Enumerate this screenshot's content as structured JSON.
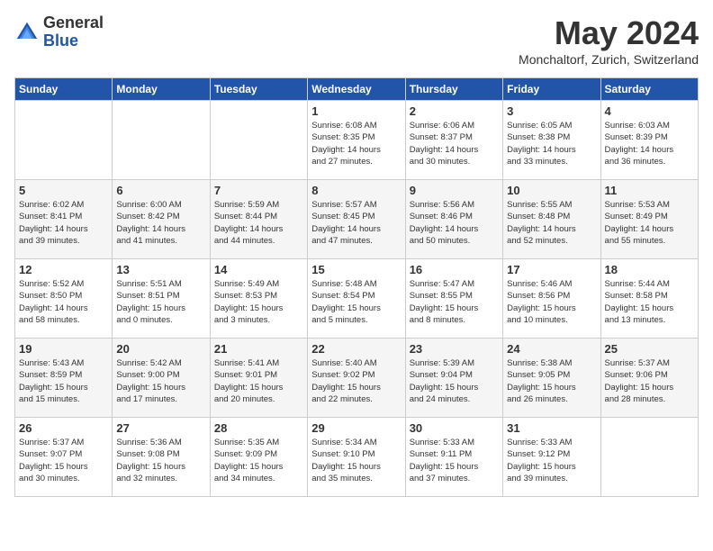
{
  "header": {
    "logo_general": "General",
    "logo_blue": "Blue",
    "title": "May 2024",
    "subtitle": "Monchaltorf, Zurich, Switzerland"
  },
  "weekdays": [
    "Sunday",
    "Monday",
    "Tuesday",
    "Wednesday",
    "Thursday",
    "Friday",
    "Saturday"
  ],
  "weeks": [
    [
      {
        "day": "",
        "info": ""
      },
      {
        "day": "",
        "info": ""
      },
      {
        "day": "",
        "info": ""
      },
      {
        "day": "1",
        "info": "Sunrise: 6:08 AM\nSunset: 8:35 PM\nDaylight: 14 hours\nand 27 minutes."
      },
      {
        "day": "2",
        "info": "Sunrise: 6:06 AM\nSunset: 8:37 PM\nDaylight: 14 hours\nand 30 minutes."
      },
      {
        "day": "3",
        "info": "Sunrise: 6:05 AM\nSunset: 8:38 PM\nDaylight: 14 hours\nand 33 minutes."
      },
      {
        "day": "4",
        "info": "Sunrise: 6:03 AM\nSunset: 8:39 PM\nDaylight: 14 hours\nand 36 minutes."
      }
    ],
    [
      {
        "day": "5",
        "info": "Sunrise: 6:02 AM\nSunset: 8:41 PM\nDaylight: 14 hours\nand 39 minutes."
      },
      {
        "day": "6",
        "info": "Sunrise: 6:00 AM\nSunset: 8:42 PM\nDaylight: 14 hours\nand 41 minutes."
      },
      {
        "day": "7",
        "info": "Sunrise: 5:59 AM\nSunset: 8:44 PM\nDaylight: 14 hours\nand 44 minutes."
      },
      {
        "day": "8",
        "info": "Sunrise: 5:57 AM\nSunset: 8:45 PM\nDaylight: 14 hours\nand 47 minutes."
      },
      {
        "day": "9",
        "info": "Sunrise: 5:56 AM\nSunset: 8:46 PM\nDaylight: 14 hours\nand 50 minutes."
      },
      {
        "day": "10",
        "info": "Sunrise: 5:55 AM\nSunset: 8:48 PM\nDaylight: 14 hours\nand 52 minutes."
      },
      {
        "day": "11",
        "info": "Sunrise: 5:53 AM\nSunset: 8:49 PM\nDaylight: 14 hours\nand 55 minutes."
      }
    ],
    [
      {
        "day": "12",
        "info": "Sunrise: 5:52 AM\nSunset: 8:50 PM\nDaylight: 14 hours\nand 58 minutes."
      },
      {
        "day": "13",
        "info": "Sunrise: 5:51 AM\nSunset: 8:51 PM\nDaylight: 15 hours\nand 0 minutes."
      },
      {
        "day": "14",
        "info": "Sunrise: 5:49 AM\nSunset: 8:53 PM\nDaylight: 15 hours\nand 3 minutes."
      },
      {
        "day": "15",
        "info": "Sunrise: 5:48 AM\nSunset: 8:54 PM\nDaylight: 15 hours\nand 5 minutes."
      },
      {
        "day": "16",
        "info": "Sunrise: 5:47 AM\nSunset: 8:55 PM\nDaylight: 15 hours\nand 8 minutes."
      },
      {
        "day": "17",
        "info": "Sunrise: 5:46 AM\nSunset: 8:56 PM\nDaylight: 15 hours\nand 10 minutes."
      },
      {
        "day": "18",
        "info": "Sunrise: 5:44 AM\nSunset: 8:58 PM\nDaylight: 15 hours\nand 13 minutes."
      }
    ],
    [
      {
        "day": "19",
        "info": "Sunrise: 5:43 AM\nSunset: 8:59 PM\nDaylight: 15 hours\nand 15 minutes."
      },
      {
        "day": "20",
        "info": "Sunrise: 5:42 AM\nSunset: 9:00 PM\nDaylight: 15 hours\nand 17 minutes."
      },
      {
        "day": "21",
        "info": "Sunrise: 5:41 AM\nSunset: 9:01 PM\nDaylight: 15 hours\nand 20 minutes."
      },
      {
        "day": "22",
        "info": "Sunrise: 5:40 AM\nSunset: 9:02 PM\nDaylight: 15 hours\nand 22 minutes."
      },
      {
        "day": "23",
        "info": "Sunrise: 5:39 AM\nSunset: 9:04 PM\nDaylight: 15 hours\nand 24 minutes."
      },
      {
        "day": "24",
        "info": "Sunrise: 5:38 AM\nSunset: 9:05 PM\nDaylight: 15 hours\nand 26 minutes."
      },
      {
        "day": "25",
        "info": "Sunrise: 5:37 AM\nSunset: 9:06 PM\nDaylight: 15 hours\nand 28 minutes."
      }
    ],
    [
      {
        "day": "26",
        "info": "Sunrise: 5:37 AM\nSunset: 9:07 PM\nDaylight: 15 hours\nand 30 minutes."
      },
      {
        "day": "27",
        "info": "Sunrise: 5:36 AM\nSunset: 9:08 PM\nDaylight: 15 hours\nand 32 minutes."
      },
      {
        "day": "28",
        "info": "Sunrise: 5:35 AM\nSunset: 9:09 PM\nDaylight: 15 hours\nand 34 minutes."
      },
      {
        "day": "29",
        "info": "Sunrise: 5:34 AM\nSunset: 9:10 PM\nDaylight: 15 hours\nand 35 minutes."
      },
      {
        "day": "30",
        "info": "Sunrise: 5:33 AM\nSunset: 9:11 PM\nDaylight: 15 hours\nand 37 minutes."
      },
      {
        "day": "31",
        "info": "Sunrise: 5:33 AM\nSunset: 9:12 PM\nDaylight: 15 hours\nand 39 minutes."
      },
      {
        "day": "",
        "info": ""
      }
    ]
  ]
}
